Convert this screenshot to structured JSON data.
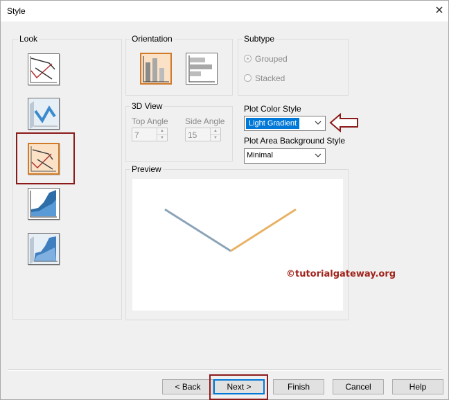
{
  "window": {
    "title": "Style",
    "close_glyph": "✕"
  },
  "look": {
    "label": "Look",
    "items": [
      {
        "name": "line-look"
      },
      {
        "name": "3d-line-look"
      },
      {
        "name": "shaded-line-look",
        "selected": true
      },
      {
        "name": "area-look"
      },
      {
        "name": "3d-area-look"
      }
    ]
  },
  "orientation": {
    "label": "Orientation",
    "selected": "vertical"
  },
  "subtype": {
    "label": "Subtype",
    "options": [
      "Grouped",
      "Stacked"
    ]
  },
  "view3d": {
    "label": "3D View",
    "top_angle_label": "Top Angle",
    "top_angle_value": "7",
    "side_angle_label": "Side Angle",
    "side_angle_value": "15"
  },
  "plot_color_style": {
    "label": "Plot Color Style",
    "value": "Light Gradient"
  },
  "plot_area_bg": {
    "label": "Plot Area Background Style",
    "value": "Minimal"
  },
  "preview": {
    "label": "Preview"
  },
  "watermark": "©tutorialgateway.org",
  "buttons": {
    "back": "< Back",
    "next": "Next >",
    "finish": "Finish",
    "cancel": "Cancel",
    "help": "Help"
  },
  "colors": {
    "highlight": "#8b1a1a",
    "selection": "#0078d7",
    "line_left": "#8aa3b8",
    "line_right": "#e8b265"
  }
}
